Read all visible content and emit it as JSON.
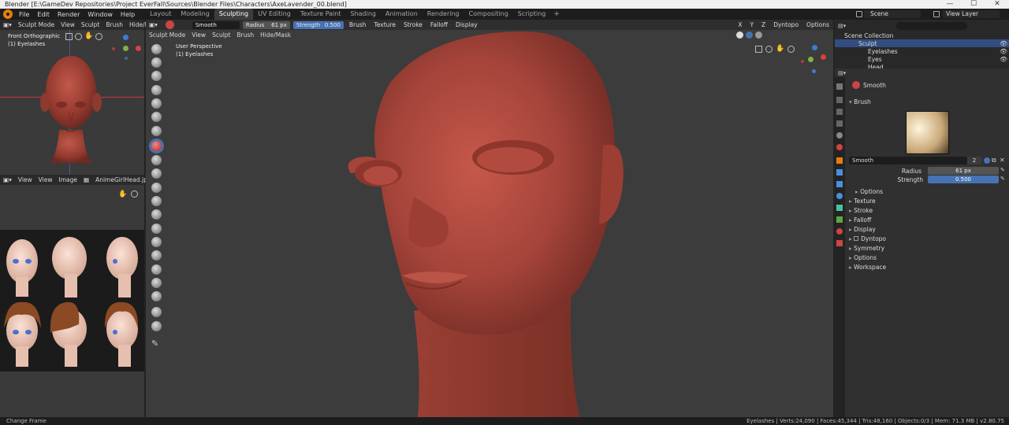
{
  "window": {
    "title": "Blender [E:\\GameDev Repositories\\Project EverFall\\Sources\\Blender Files\\Characters\\AxeLavender_00.blend]",
    "minimize": "—",
    "maximize": "☐",
    "close": "✕"
  },
  "menubar": {
    "menus": [
      "File",
      "Edit",
      "Render",
      "Window",
      "Help"
    ],
    "workspaces": [
      "Layout",
      "Modeling",
      "Sculpting",
      "UV Editing",
      "Texture Paint",
      "Shading",
      "Animation",
      "Rendering",
      "Compositing",
      "Scripting"
    ],
    "active_workspace": "Sculpting",
    "add_tab": "+",
    "scene": "Scene",
    "view_layer": "View Layer"
  },
  "left_viewport": {
    "mode": "Sculpt Mode",
    "menus": [
      "View",
      "Sculpt",
      "Brush",
      "Hide/Mask"
    ],
    "view_name": "Front Orthographic",
    "object": "(1) Eyelashes"
  },
  "image_editor": {
    "menus": [
      "View",
      "View",
      "Image"
    ],
    "image_name": "AnimeGirlHead.jpg"
  },
  "main_viewport": {
    "brush_name": "Smooth",
    "radius_label": "Radius",
    "radius_value": "61 px",
    "strength_label": "Strength",
    "strength_value": "0.500",
    "dropdowns": [
      "Brush",
      "Texture",
      "Stroke",
      "Falloff",
      "Display"
    ],
    "mode": "Sculpt Mode",
    "menus": [
      "View",
      "Sculpt",
      "Brush",
      "Hide/Mask"
    ],
    "view_name": "User Perspective",
    "object": "(1) Eyelashes",
    "axes": [
      "X",
      "Y",
      "Z"
    ],
    "dyntopo": "Dyntopo",
    "options": "Options"
  },
  "outliner": {
    "root": "Scene Collection",
    "items": [
      "Sculpt",
      "Eyelashes",
      "Eyes",
      "Head"
    ]
  },
  "properties": {
    "brush_title": "Smooth",
    "section_brush": "Brush",
    "brush_field": "Smooth",
    "brush_users": "2",
    "radius_label": "Radius",
    "radius_value": "61 px",
    "strength_label": "Strength",
    "strength_value": "0.500",
    "sections": [
      "Options",
      "Texture",
      "Stroke",
      "Falloff",
      "Display",
      "Dyntopo",
      "Symmetry",
      "Options",
      "Workspace"
    ]
  },
  "statusbar": {
    "left": "Change Frame",
    "right": "Eyelashes | Verts:24,090 | Faces:45,344 | Tris:48,160 | Objects:0/3 | Mem: 71.3 MB | v2.80.75"
  },
  "colors": {
    "accent": "#4772b3",
    "skin": "#a8463a",
    "blender_orange": "#e87d0d"
  }
}
